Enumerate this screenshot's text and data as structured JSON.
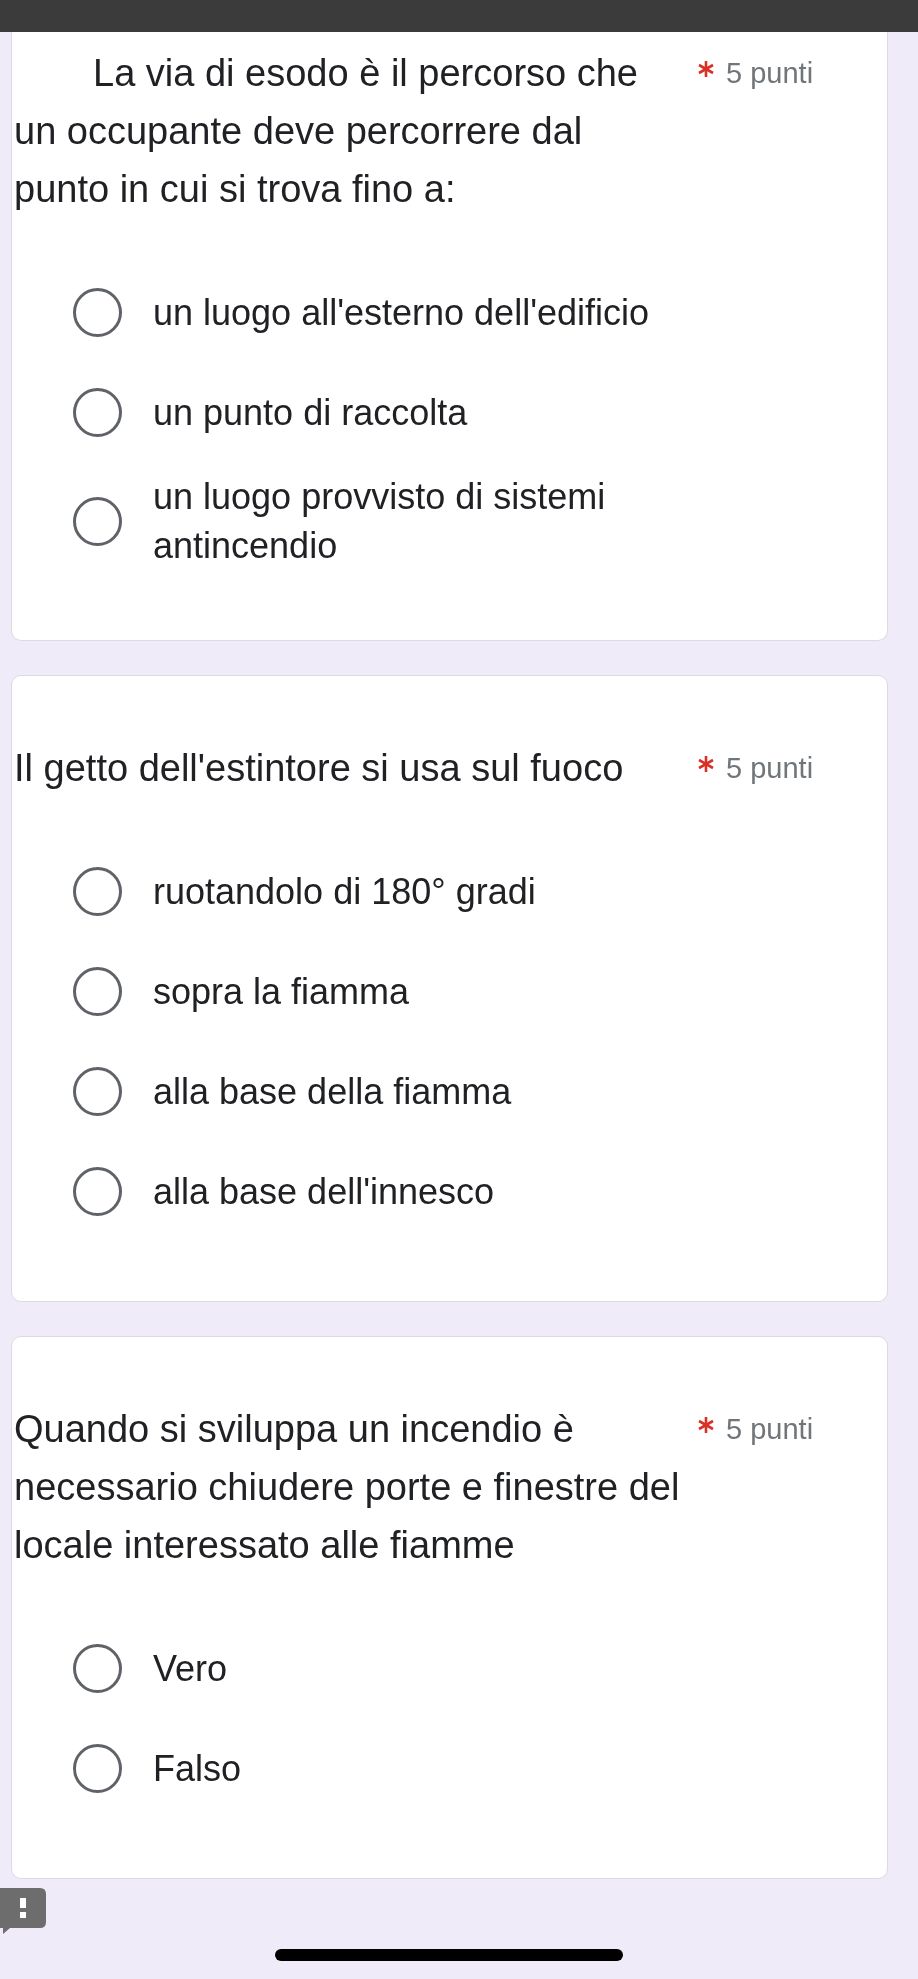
{
  "questions": [
    {
      "title": "La via di esodo è il percorso che un occupante deve percorrere dal punto in cui si trova fino a:",
      "required": true,
      "points": "5 punti",
      "options": [
        {
          "label": "un luogo all'esterno dell'edificio",
          "selected": false
        },
        {
          "label": "un punto di raccolta",
          "selected": false
        },
        {
          "label": "un luogo provvisto di sistemi antincendio",
          "selected": false
        }
      ]
    },
    {
      "title": "Il getto dell'estintore si usa sul fuoco",
      "required": true,
      "points": "5 punti",
      "options": [
        {
          "label": "ruotandolo di 180° gradi",
          "selected": false
        },
        {
          "label": "sopra la fiamma",
          "selected": false
        },
        {
          "label": "alla base della fiamma",
          "selected": false
        },
        {
          "label": "alla base dell'innesco",
          "selected": false
        }
      ]
    },
    {
      "title": "Quando si sviluppa un incendio è necessario chiudere porte e finestre del locale interessato alle fiamme",
      "required": true,
      "points": "5 punti",
      "options": [
        {
          "label": "Vero",
          "selected": false
        },
        {
          "label": "Falso",
          "selected": false
        }
      ]
    }
  ]
}
